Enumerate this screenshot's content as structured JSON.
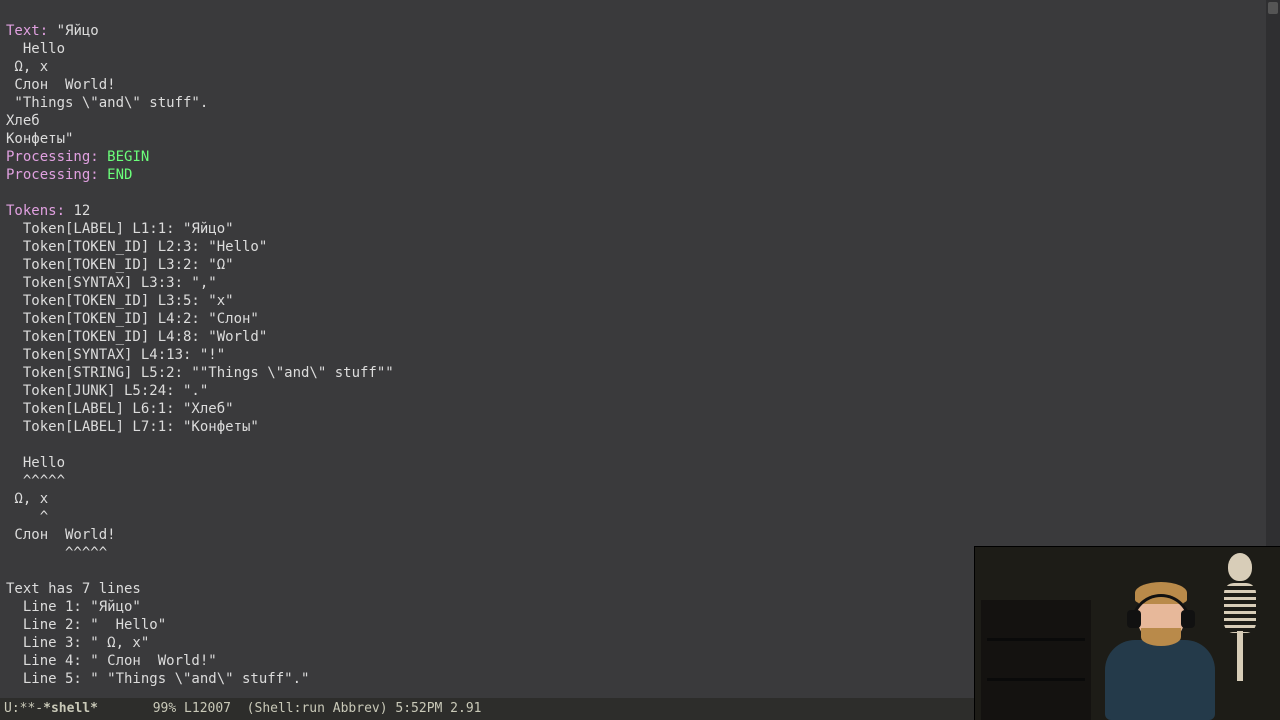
{
  "header": {
    "text_label": "Text:",
    "text_value": " \"Яйцо",
    "raw_lines": [
      "  Hello",
      " Ω, x",
      " Слон  World!",
      " \"Things \\\"and\\\" stuff\".",
      "Хлеб",
      "Конфеты\""
    ]
  },
  "processing": {
    "label": "Processing:",
    "begin": "BEGIN",
    "end": "END"
  },
  "tokens_header": {
    "label": "Tokens:",
    "count": "12"
  },
  "tokens": [
    "  Token[LABEL] L1:1: \"Яйцо\"",
    "  Token[TOKEN_ID] L2:3: \"Hello\"",
    "  Token[TOKEN_ID] L3:2: \"Ω\"",
    "  Token[SYNTAX] L3:3: \",\"",
    "  Token[TOKEN_ID] L3:5: \"x\"",
    "  Token[TOKEN_ID] L4:2: \"Слон\"",
    "  Token[TOKEN_ID] L4:8: \"World\"",
    "  Token[SYNTAX] L4:13: \"!\"",
    "  Token[STRING] L5:2: \"\"Things \\\"and\\\" stuff\"\"",
    "  Token[JUNK] L5:24: \".\"",
    "  Token[LABEL] L6:1: \"Хлеб\"",
    "  Token[LABEL] L7:1: \"Конфеты\""
  ],
  "caret_block": [
    "",
    "  Hello",
    "  ^^^^^",
    " Ω, x",
    "    ^",
    " Слон  World!",
    "       ^^^^^",
    ""
  ],
  "lines_summary": {
    "header": "Text has 7 lines",
    "lines": [
      "  Line 1: \"Яйцо\"",
      "  Line 2: \"  Hello\"",
      "  Line 3: \" Ω, x\"",
      "  Line 4: \" Слон  World!\"",
      "  Line 5: \" \"Things \\\"and\\\" stuff\".\""
    ]
  },
  "modeline": {
    "status": "U:**-",
    "buffer": "*shell*",
    "gap1": "       ",
    "pos": "99% L12007",
    "gap2": "  ",
    "mode": "(Shell:run Abbrev)",
    "time": " 5:52PM",
    "load": " 2.91"
  }
}
